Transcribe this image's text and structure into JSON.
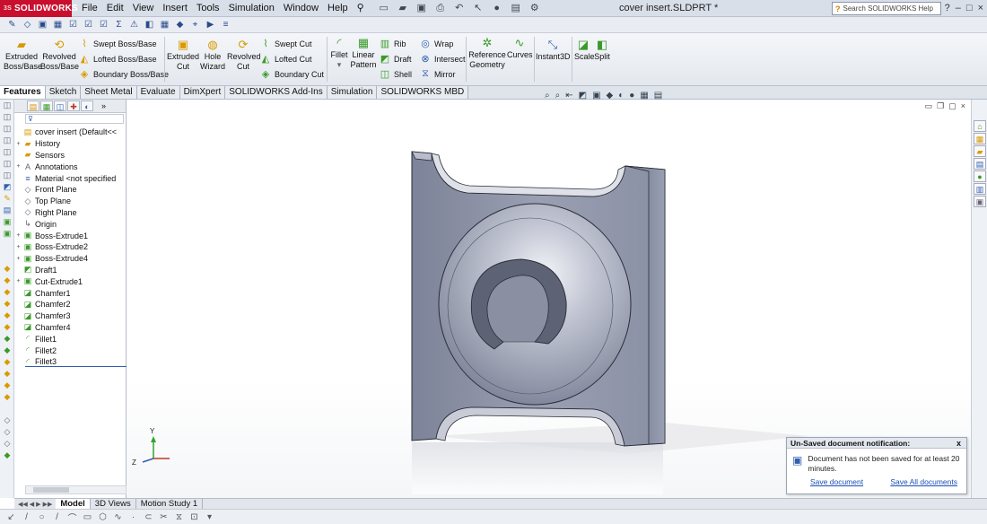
{
  "app": {
    "logo_text": "SOLIDWORKS",
    "logo_prefix": "3S",
    "document_title": "cover insert.SLDPRT *"
  },
  "menu": [
    "File",
    "Edit",
    "View",
    "Insert",
    "Tools",
    "Simulation",
    "Window",
    "Help"
  ],
  "search": {
    "placeholder": "Search SOLIDWORKS Help"
  },
  "command_manager": {
    "extruded_boss": [
      "Extruded",
      "Boss/Base"
    ],
    "revolved_boss": [
      "Revolved",
      "Boss/Base"
    ],
    "swept_boss": "Swept Boss/Base",
    "lofted_boss": "Lofted Boss/Base",
    "boundary_boss": "Boundary Boss/Base",
    "extruded_cut": [
      "Extruded",
      "Cut"
    ],
    "hole_wizard": [
      "Hole",
      "Wizard"
    ],
    "revolved_cut": [
      "Revolved",
      "Cut"
    ],
    "swept_cut": "Swept Cut",
    "lofted_cut": "Lofted Cut",
    "boundary_cut": "Boundary Cut",
    "fillet": "Fillet",
    "linear_pattern": [
      "Linear",
      "Pattern"
    ],
    "rib": "Rib",
    "draft": "Draft",
    "shell": "Shell",
    "wrap": "Wrap",
    "intersect": "Intersect",
    "mirror": "Mirror",
    "reference_geometry": [
      "Reference",
      "Geometry"
    ],
    "curves": "Curves",
    "instant3d": "Instant3D",
    "scale": "Scale",
    "split": "Split"
  },
  "tabs": [
    "Features",
    "Sketch",
    "Sheet Metal",
    "Evaluate",
    "DimXpert",
    "SOLIDWORKS Add-Ins",
    "Simulation",
    "SOLIDWORKS MBD"
  ],
  "feature_tree": [
    {
      "label": "cover insert  (Default<<",
      "icon": "part-icon",
      "expand": ""
    },
    {
      "label": "History",
      "icon": "folder-icon",
      "expand": "+"
    },
    {
      "label": "Sensors",
      "icon": "folder-icon",
      "expand": ""
    },
    {
      "label": "Annotations",
      "icon": "annotation-icon",
      "expand": "+"
    },
    {
      "label": "Material <not specified",
      "icon": "material-icon",
      "expand": ""
    },
    {
      "label": "Front Plane",
      "icon": "plane-icon",
      "expand": ""
    },
    {
      "label": "Top Plane",
      "icon": "plane-icon",
      "expand": ""
    },
    {
      "label": "Right Plane",
      "icon": "plane-icon",
      "expand": ""
    },
    {
      "label": "Origin",
      "icon": "origin-icon",
      "expand": ""
    },
    {
      "label": "Boss-Extrude1",
      "icon": "boss-icon",
      "expand": "+"
    },
    {
      "label": "Boss-Extrude2",
      "icon": "boss-icon",
      "expand": "+"
    },
    {
      "label": "Boss-Extrude4",
      "icon": "boss-icon",
      "expand": "+"
    },
    {
      "label": "Draft1",
      "icon": "draft-icon",
      "expand": ""
    },
    {
      "label": "Cut-Extrude1",
      "icon": "cut-icon",
      "expand": "+"
    },
    {
      "label": "Chamfer1",
      "icon": "chamfer-icon",
      "expand": ""
    },
    {
      "label": "Chamfer2",
      "icon": "chamfer-icon",
      "expand": ""
    },
    {
      "label": "Chamfer3",
      "icon": "chamfer-icon",
      "expand": ""
    },
    {
      "label": "Chamfer4",
      "icon": "chamfer-icon",
      "expand": ""
    },
    {
      "label": "Fillet1",
      "icon": "fillet-icon",
      "expand": ""
    },
    {
      "label": "Fillet2",
      "icon": "fillet-icon",
      "expand": ""
    },
    {
      "label": "Fillet3",
      "icon": "fillet-icon",
      "expand": ""
    }
  ],
  "bottom_tabs": [
    "Model",
    "3D Views",
    "Motion Study 1"
  ],
  "triad": {
    "y": "Y",
    "z": "Z"
  },
  "notification": {
    "title": "Un-Saved document notification:",
    "close": "x",
    "message": "Document has not been saved for at least 20 minutes.",
    "save": "Save document",
    "save_all": "Save All documents"
  },
  "colors": {
    "logo_red": "#c8102e",
    "part_gray": "#8d93a6",
    "link_blue": "#1a4fb5"
  }
}
